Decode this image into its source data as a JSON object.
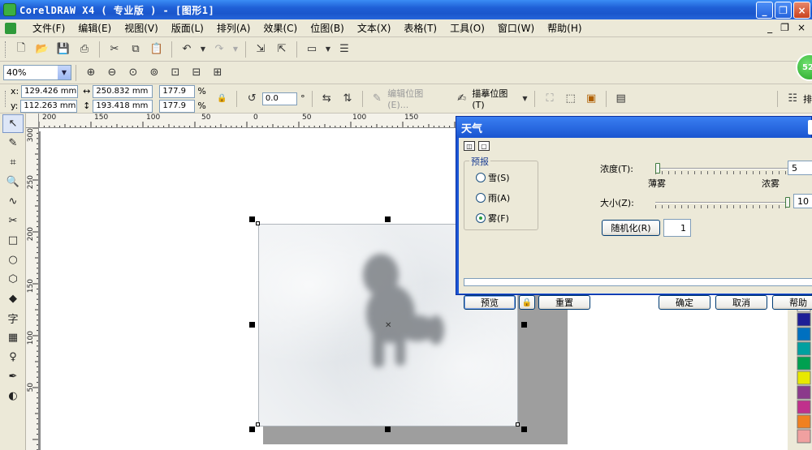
{
  "window": {
    "title": "CorelDRAW X4 ( 专业版 ) - [图形1]",
    "buttons": [
      "_",
      "❐",
      "×"
    ]
  },
  "menubar": {
    "items": [
      "文件(F)",
      "编辑(E)",
      "视图(V)",
      "版面(L)",
      "排列(A)",
      "效果(C)",
      "位图(B)",
      "文本(X)",
      "表格(T)",
      "工具(O)",
      "窗口(W)",
      "帮助(H)"
    ],
    "mdi_buttons": [
      "_",
      "❐",
      "×"
    ]
  },
  "toolbar2": {
    "zoom": "40%"
  },
  "properties": {
    "x_label": "x:",
    "y_label": "y:",
    "x": "129.426 mm",
    "y": "112.263 mm",
    "width": "250.832 mm",
    "height": "193.418 mm",
    "scale_x": "177.9",
    "scale_y": "177.9",
    "percent": "%",
    "rotation": "0.0",
    "degree": "°",
    "edit_bitmap": "编辑位图(E)...",
    "trace_bitmap": "描摹位图(T)",
    "right_label": "排"
  },
  "rulers": {
    "h_labels": [
      "200",
      "150",
      "100",
      "50",
      "0",
      "50",
      "100",
      "150"
    ],
    "v_labels": [
      "300",
      "250",
      "200",
      "150",
      "100",
      "50"
    ]
  },
  "toolbox": {
    "glyphs": [
      "↖",
      "✎",
      "⌗",
      "🔍",
      "∿",
      "✂",
      "□",
      "○",
      "⬡",
      "◆",
      "字",
      "▦",
      "♀",
      "✒",
      "◐"
    ]
  },
  "palette": {
    "colors": [
      "#ffffff",
      "#1e1e96",
      "#0070c0",
      "#00a0a0",
      "#00a050",
      "#e8e800",
      "#8b3a8b",
      "#c0308c",
      "#f08020",
      "#f0a0a0"
    ]
  },
  "widget": {
    "text": "52"
  },
  "dialog": {
    "title": "天气",
    "forecast_group": "预报",
    "options": [
      {
        "label": "雪(S)",
        "checked": false
      },
      {
        "label": "雨(A)",
        "checked": false
      },
      {
        "label": "雾(F)",
        "checked": true
      }
    ],
    "density_label": "浓度(T):",
    "density_min": "薄雾",
    "density_max": "浓雾",
    "density_value": "5",
    "density_fraction": 0.0,
    "size_label": "大小(Z):",
    "size_value": "10",
    "size_fraction": 1.0,
    "randomize_label": "随机化(R)",
    "randomize_value": "1",
    "preview_label": "预览",
    "reset_label": "重置",
    "ok_label": "确定",
    "cancel_label": "取消",
    "help_label": "帮助"
  }
}
